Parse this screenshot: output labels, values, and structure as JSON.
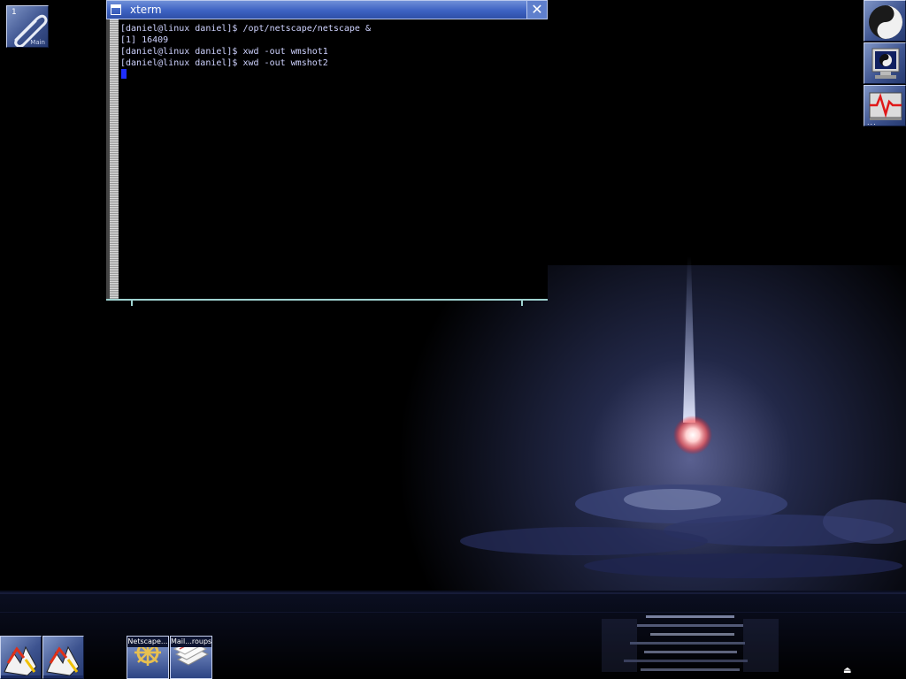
{
  "desktop": {
    "workspace_clip": {
      "number": "1",
      "caption": "Main"
    }
  },
  "xterm": {
    "title": "xterm",
    "close_glyph": "✕",
    "lines": [
      "[daniel@linux daniel]$ /opt/netscape/netscape &",
      "[1] 16409",
      "[daniel@linux daniel]$ xwd -out wmshot1",
      "[daniel@linux daniel]$ xwd -out wmshot2"
    ],
    "text_color": "#cfd3ff",
    "cursor_color": "#1f2fff"
  },
  "dock_right": [
    {
      "name": "gnu-dock-icon"
    },
    {
      "name": "monitor-icon"
    },
    {
      "name": "system-monitor-icon",
      "dots": "..."
    }
  ],
  "taskbar": [
    {
      "label": "Netscape..."
    },
    {
      "label": "Mail...roups"
    }
  ],
  "colors": {
    "titlebar": "#3d62c2",
    "resize_bar": "#9fd2d0"
  }
}
